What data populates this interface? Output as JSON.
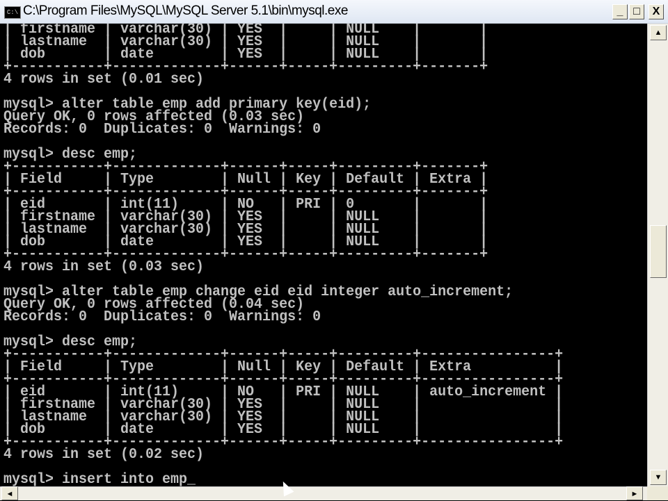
{
  "window": {
    "title": "C:\\Program Files\\MySQL\\MySQL Server 5.1\\bin\\mysql.exe",
    "icon_text": "C:\\",
    "minimize": "_",
    "maximize": "□",
    "close": "X"
  },
  "console": {
    "lines": [
      "| firstname | varchar(30) | YES  |     | NULL    |       |",
      "| lastname  | varchar(30) | YES  |     | NULL    |       |",
      "| dob       | date        | YES  |     | NULL    |       |",
      "+-----------+-------------+------+-----+---------+-------+",
      "4 rows in set (0.01 sec)",
      "",
      "mysql> alter table emp add primary key(eid);",
      "Query OK, 0 rows affected (0.03 sec)",
      "Records: 0  Duplicates: 0  Warnings: 0",
      "",
      "mysql> desc emp;",
      "+-----------+-------------+------+-----+---------+-------+",
      "| Field     | Type        | Null | Key | Default | Extra |",
      "+-----------+-------------+------+-----+---------+-------+",
      "| eid       | int(11)     | NO   | PRI | 0       |       |",
      "| firstname | varchar(30) | YES  |     | NULL    |       |",
      "| lastname  | varchar(30) | YES  |     | NULL    |       |",
      "| dob       | date        | YES  |     | NULL    |       |",
      "+-----------+-------------+------+-----+---------+-------+",
      "4 rows in set (0.03 sec)",
      "",
      "mysql> alter table emp change eid eid integer auto_increment;",
      "Query OK, 0 rows affected (0.04 sec)",
      "Records: 0  Duplicates: 0  Warnings: 0",
      "",
      "mysql> desc emp;",
      "+-----------+-------------+------+-----+---------+----------------+",
      "| Field     | Type        | Null | Key | Default | Extra          |",
      "+-----------+-------------+------+-----+---------+----------------+",
      "| eid       | int(11)     | NO   | PRI | NULL    | auto_increment |",
      "| firstname | varchar(30) | YES  |     | NULL    |                |",
      "| lastname  | varchar(30) | YES  |     | NULL    |                |",
      "| dob       | date        | YES  |     | NULL    |                |",
      "+-----------+-------------+------+-----+---------+----------------+",
      "4 rows in set (0.02 sec)",
      "",
      "mysql> insert into emp_"
    ]
  },
  "scrollbar": {
    "up": "▲",
    "down": "▼",
    "left": "◄",
    "right": "►"
  }
}
